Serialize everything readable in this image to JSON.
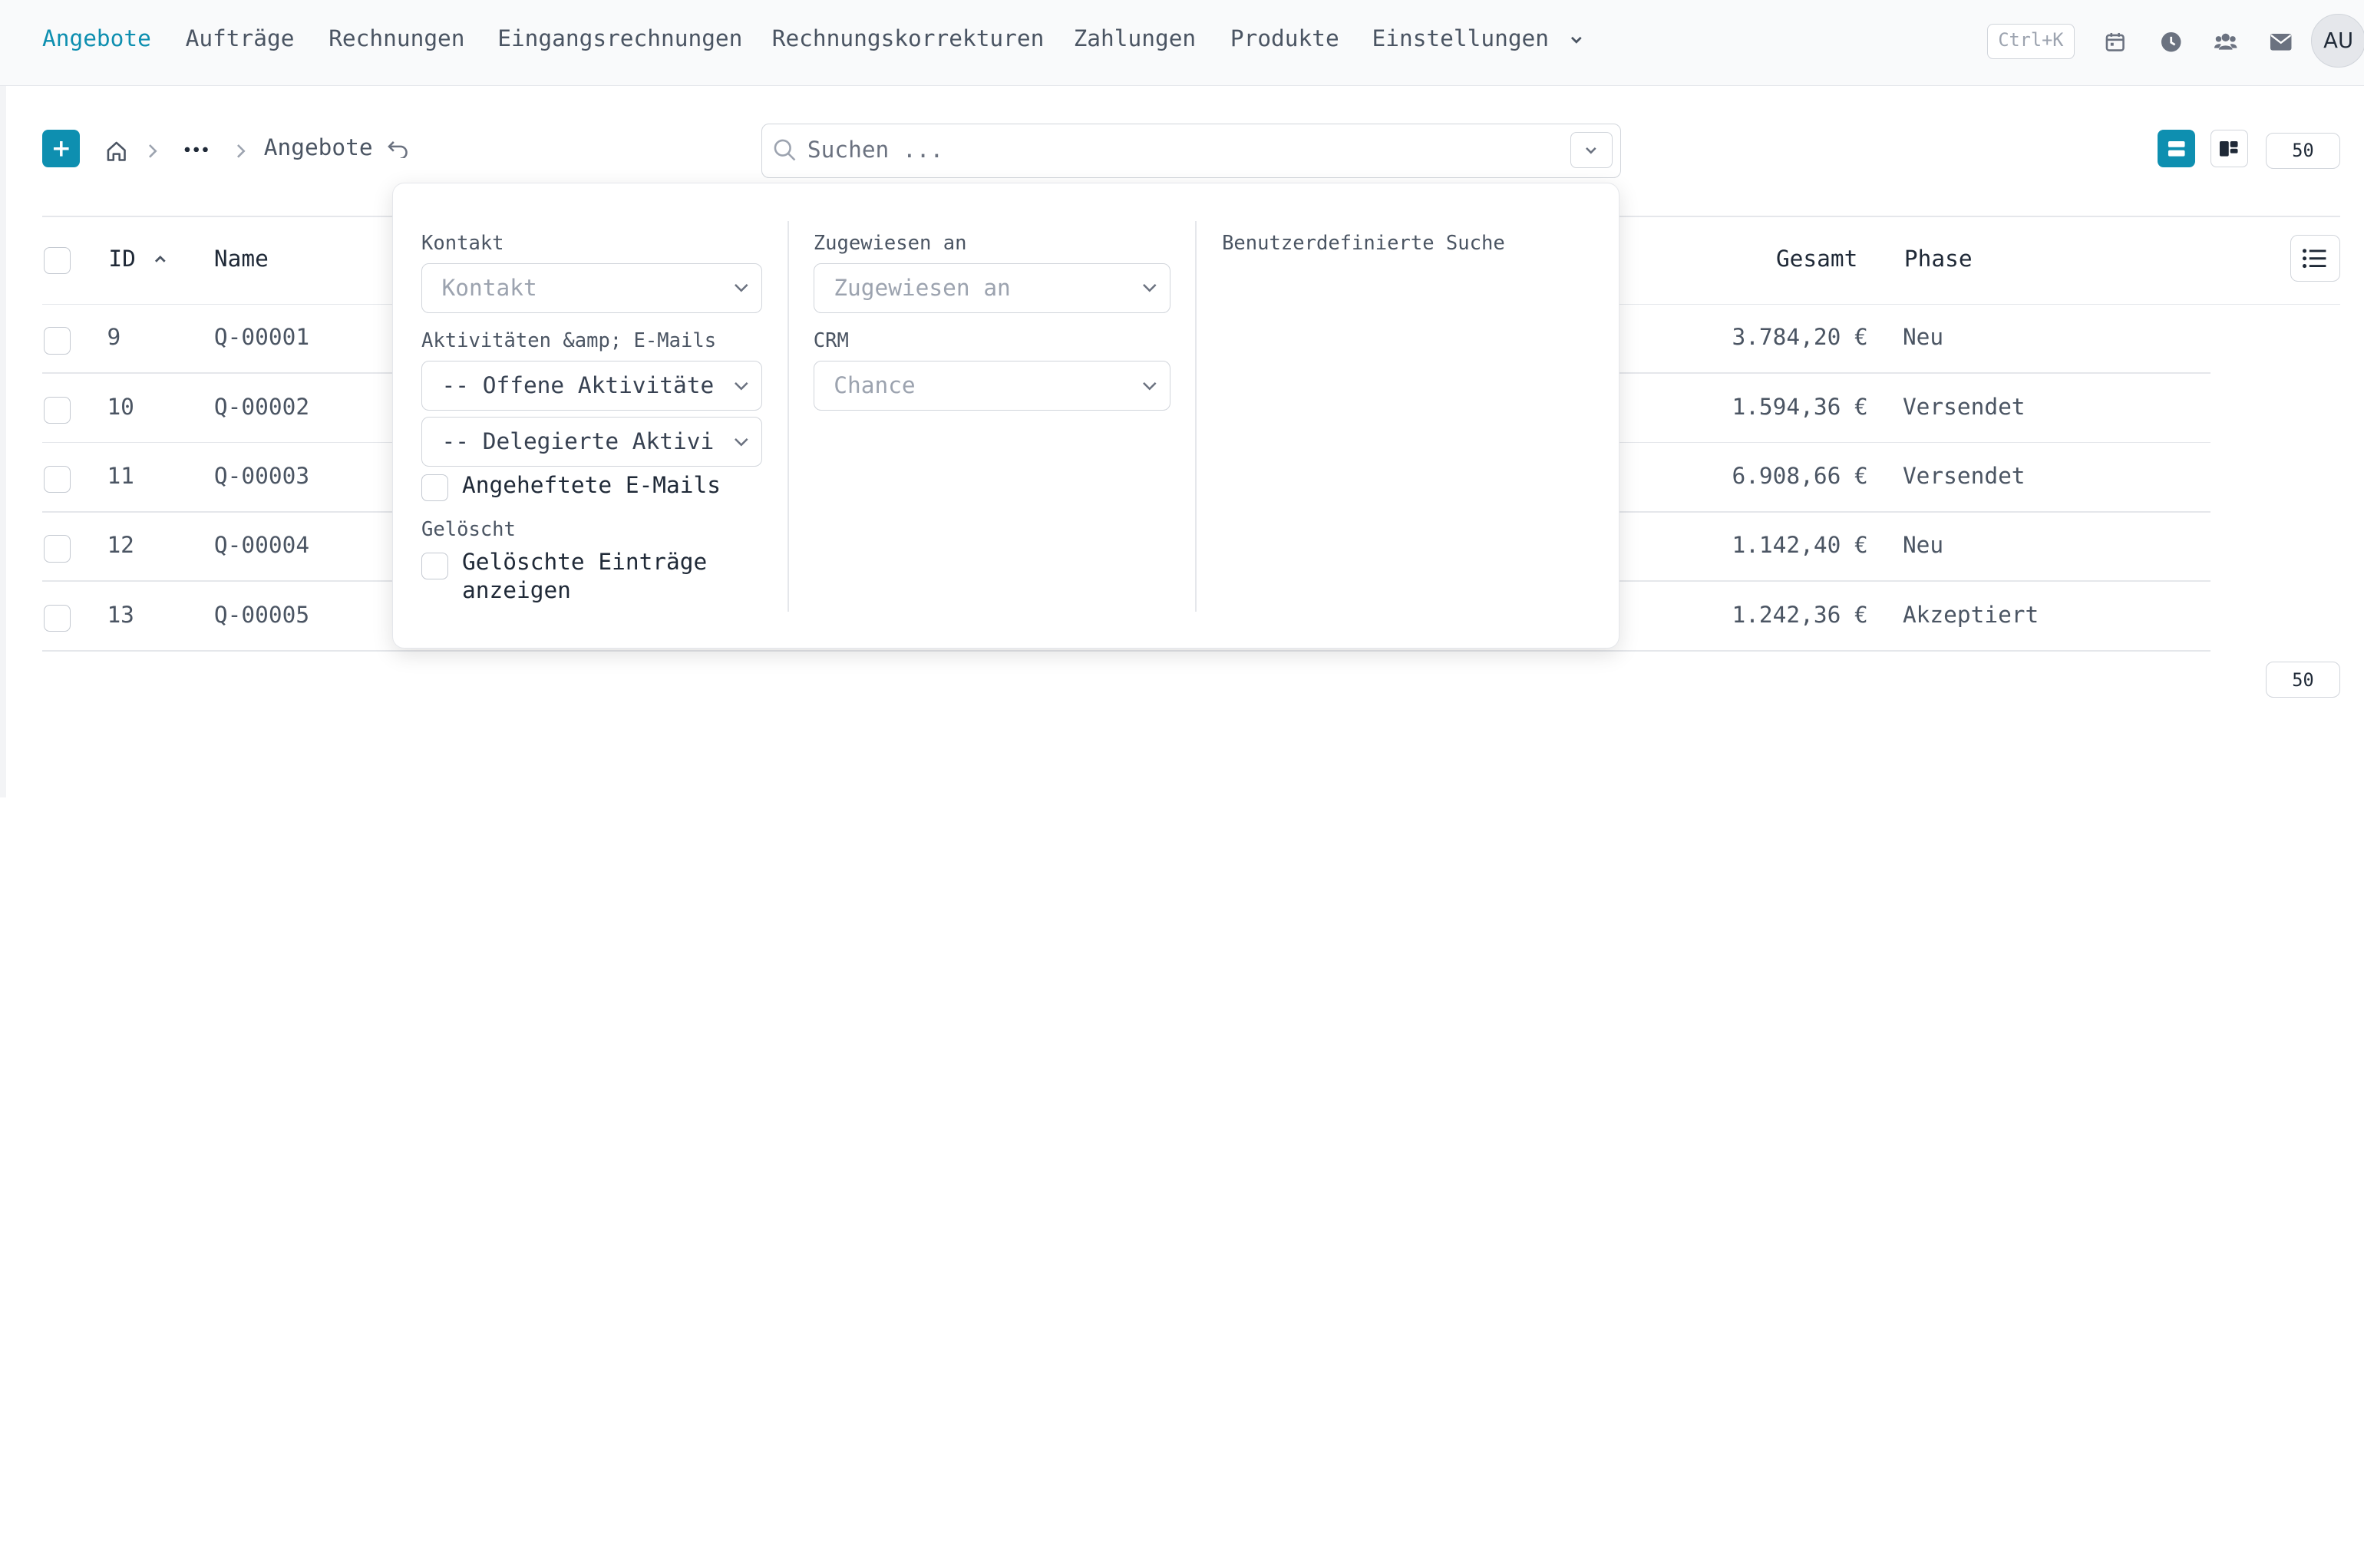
{
  "nav": {
    "items": [
      {
        "label": "Angebote",
        "active": true
      },
      {
        "label": "Aufträge"
      },
      {
        "label": "Rechnungen"
      },
      {
        "label": "Eingangsrechnungen"
      },
      {
        "label": "Rechnungskorrekturen"
      },
      {
        "label": "Zahlungen"
      },
      {
        "label": "Produkte"
      },
      {
        "label": "Einstellungen"
      }
    ],
    "shortcut": "Ctrl+K",
    "avatar_initials": "AU",
    "icons": [
      "calendar-icon",
      "clock-icon",
      "users-icon",
      "mail-icon"
    ]
  },
  "toolbar": {
    "breadcrumb_current": "Angebote",
    "search_placeholder": "Suchen ...",
    "page_size": "50"
  },
  "table": {
    "headers": {
      "id": "ID",
      "name": "Name",
      "total": "Gesamt",
      "phase": "Phase"
    },
    "rows": [
      {
        "id": "9",
        "name": "Q-00001",
        "total": "3.784,20 €",
        "phase": "Neu"
      },
      {
        "id": "10",
        "name": "Q-00002",
        "total": "1.594,36 €",
        "phase": "Versendet"
      },
      {
        "id": "11",
        "name": "Q-00003",
        "total": "6.908,66 €",
        "phase": "Versendet"
      },
      {
        "id": "12",
        "name": "Q-00004",
        "total": "1.142,40 €",
        "phase": "Neu"
      },
      {
        "id": "13",
        "name": "Q-00005",
        "total": "1.242,36 €",
        "phase": "Akzeptiert"
      }
    ],
    "footer_page_size": "50"
  },
  "filter": {
    "kontakt_label": "Kontakt",
    "kontakt_placeholder": "Kontakt",
    "aktivitaeten_label": "Aktivitäten &amp; E-Mails",
    "offene_aktivitaeten": "-- Offene Aktivitäten --",
    "delegierte_aktivitaeten": "-- Delegierte Aktivitäten --",
    "angeheftete_emails": "Angeheftete E-Mails",
    "geloescht_label": "Gelöscht",
    "geloeschte_eintraege_line1": "Gelöschte Einträge",
    "geloeschte_eintraege_line2": "anzeigen",
    "zugewiesen_label": "Zugewiesen an",
    "zugewiesen_placeholder": "Zugewiesen an",
    "crm_label": "CRM",
    "crm_placeholder": "Chance",
    "custom_search_label": "Benutzerdefinierte Suche"
  },
  "colors": {
    "accent": "#0e8fb0"
  }
}
